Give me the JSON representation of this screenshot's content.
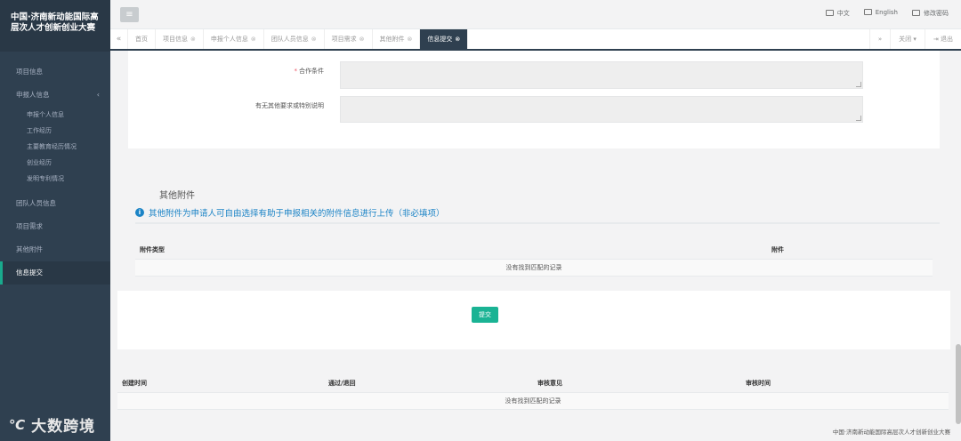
{
  "app": {
    "title": "中国·济南新动能国际高层次人才创新创业大赛"
  },
  "sidebar": {
    "items": [
      {
        "label": "项目信息"
      },
      {
        "label": "申报人信息",
        "expanded": true,
        "children": [
          {
            "label": "申报个人信息"
          },
          {
            "label": "工作经历"
          },
          {
            "label": "主要教育经历情况"
          },
          {
            "label": "创业经历"
          },
          {
            "label": "发明专利情况"
          }
        ]
      },
      {
        "label": "团队人员信息"
      },
      {
        "label": "项目需求"
      },
      {
        "label": "其他附件"
      },
      {
        "label": "信息提交",
        "active": true
      }
    ]
  },
  "topbar": {
    "menu_icon": "≡",
    "links": [
      {
        "icon": "keyboard-icon",
        "label": "中文"
      },
      {
        "icon": "keyboard-icon",
        "label": "English"
      },
      {
        "icon": "keyboard-icon",
        "label": "修改密码"
      }
    ]
  },
  "tabs": {
    "items": [
      {
        "label": "首页",
        "closable": false
      },
      {
        "label": "项目信息",
        "closable": true
      },
      {
        "label": "申报个人信息",
        "closable": true
      },
      {
        "label": "团队人员信息",
        "closable": true
      },
      {
        "label": "项目需求",
        "closable": true
      },
      {
        "label": "其他附件",
        "closable": true
      },
      {
        "label": "信息提交",
        "closable": true,
        "active": true
      }
    ],
    "close_label": "关闭",
    "logout_label": "退出"
  },
  "form": {
    "cooperation_label": "合作条件",
    "special_label": "有无其他要求或特别说明"
  },
  "attachments": {
    "title": "其他附件",
    "info": "其他附件为申请人可自由选择有助于申报相关的附件信息进行上传（非必填项）",
    "col_type": "附件类型",
    "col_file": "附件",
    "empty": "没有找到匹配的记录"
  },
  "submit_label": "提交",
  "audit_table": {
    "columns": [
      "创建时间",
      "通过/退回",
      "审核意见",
      "审核时间"
    ],
    "empty": "没有找到匹配的记录"
  },
  "footer": "中国·济南新动能国际高层次人才创新创业大赛",
  "watermark": "大数跨境",
  "colors": {
    "sidebar_bg": "#2f4050",
    "accent": "#1ab394",
    "info": "#1c84c6"
  }
}
